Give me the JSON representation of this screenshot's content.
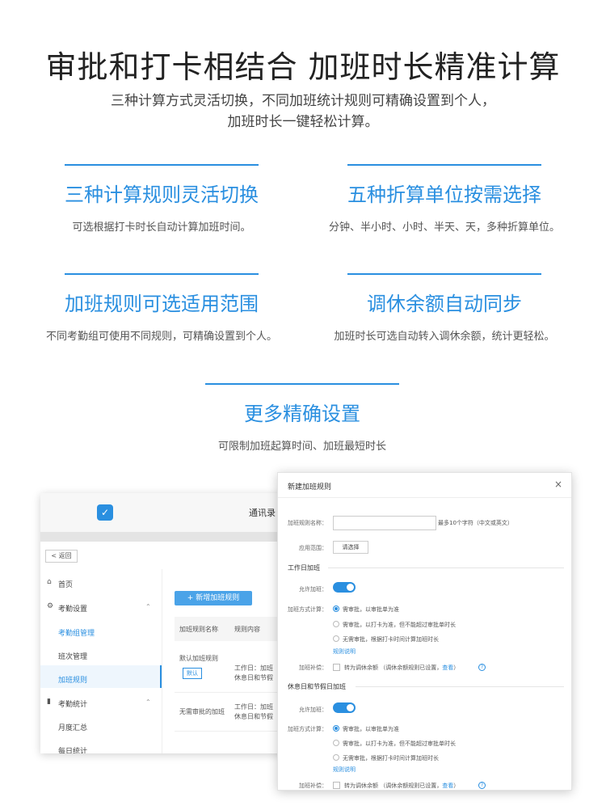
{
  "hero": {
    "title": "审批和打卡相结合 加班时长精准计算",
    "subtitle_line1": "三种计算方式灵活切换，不同加班统计规则可精确设置到个人，",
    "subtitle_line2": "加班时长一键轻松计算。"
  },
  "features": [
    {
      "title": "三种计算规则灵活切换",
      "desc": "可选根据打卡时长自动计算加班时间。"
    },
    {
      "title": "五种折算单位按需选择",
      "desc": "分钟、半小时、小时、半天、天，多种折算单位。"
    },
    {
      "title": "加班规则可选适用范围",
      "desc": "不同考勤组可使用不同规则，可精确设置到个人。"
    },
    {
      "title": "调休余额自动同步",
      "desc": "加班时长可选自动转入调休余额，统计更轻松。"
    },
    {
      "title": "更多精确设置",
      "desc": "可限制加班起算时间、加班最短时长"
    }
  ],
  "app": {
    "nav_label": "通讯录",
    "back": "返回",
    "sidebar": {
      "home": "首页",
      "attendance_settings": "考勤设置",
      "group_mgmt": "考勤组管理",
      "shift_mgmt": "班次管理",
      "overtime_rules": "加班规则",
      "attendance_stats": "考勤统计",
      "monthly": "月度汇总",
      "daily": "每日统计"
    },
    "add_rule": "+ 新增加班规则",
    "table": {
      "col_name": "加班规则名称",
      "col_content": "规则内容",
      "row1_name": "默认加班规则",
      "row1_tag": "默认",
      "row1_content1": "工作日：加班",
      "row1_content2": "休息日和节假",
      "row2_name": "无需审批的加班",
      "row2_content1": "工作日：加班",
      "row2_content2": "休息日和节假"
    }
  },
  "dialog": {
    "title": "新建加班规则",
    "close": "×",
    "name_label": "加班规则名称：",
    "name_hint": "最多10个字符（中文或英文）",
    "scope_label": "应用范围：",
    "scope_button": "请选择",
    "workday_section": "工作日加班",
    "allow_label": "允许加班：",
    "method_label": "加班方式计算：",
    "option1": "需审批，以审批单为准",
    "option2": "需审批，以打卡为准，但不能超过审批单时长",
    "option3": "无需审批，根据打卡时间计算加班时长",
    "rule_desc": "规则说明",
    "comp_label": "加班补偿：",
    "comp_text": "转为调休余额",
    "comp_note": "（调休余额规则已设置，",
    "comp_view": "查看",
    "comp_end": "）",
    "holiday_section": "休息日和节假日加班"
  },
  "colors": {
    "accent": "#2a8fe0"
  }
}
